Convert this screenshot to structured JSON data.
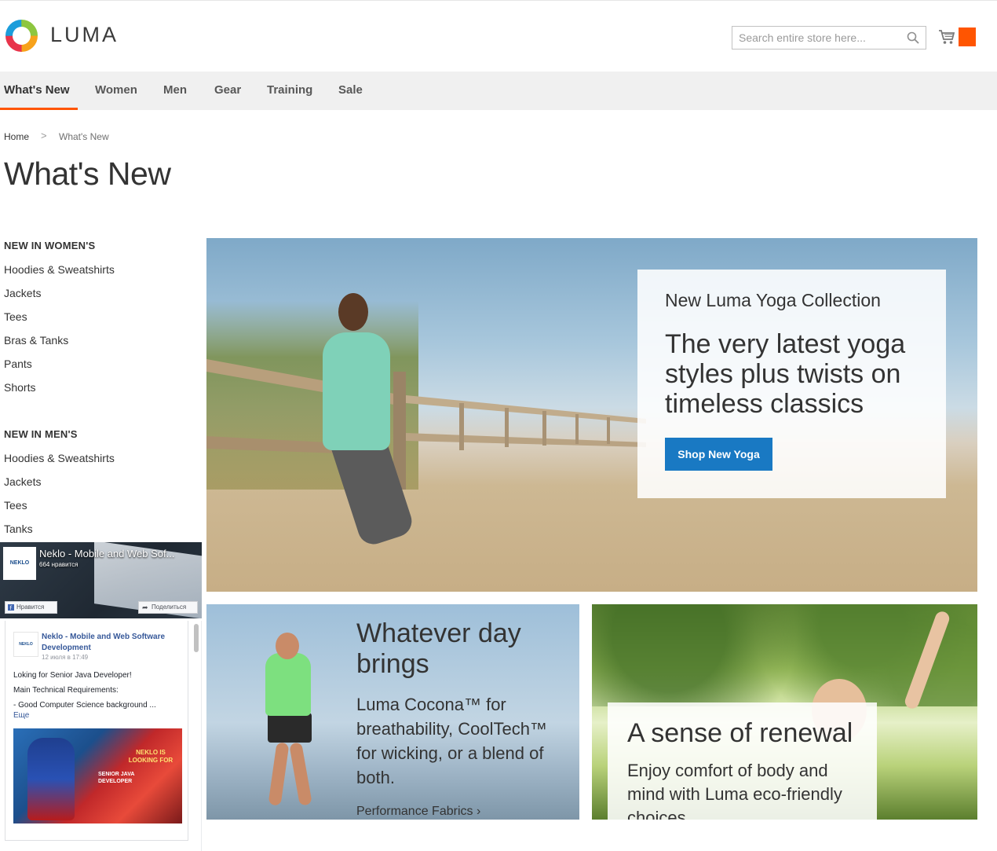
{
  "brand": {
    "name": "LUMA"
  },
  "search": {
    "placeholder": "Search entire store here..."
  },
  "icons": {
    "search": "search-icon",
    "cart": "cart-icon"
  },
  "colors": {
    "accent": "#ff5501",
    "button_primary": "#1979c3",
    "nav_bg": "#f0f0f0"
  },
  "nav": {
    "items": [
      {
        "label": "What's New",
        "active": true
      },
      {
        "label": "Women"
      },
      {
        "label": "Men"
      },
      {
        "label": "Gear"
      },
      {
        "label": "Training"
      },
      {
        "label": "Sale"
      }
    ]
  },
  "breadcrumb": {
    "home": "Home",
    "separator": ">",
    "current": "What's New"
  },
  "page": {
    "title": "What's New"
  },
  "sidebar": {
    "women": {
      "heading": "NEW IN WOMEN'S",
      "items": [
        "Hoodies & Sweatshirts",
        "Jackets",
        "Tees",
        "Bras & Tanks",
        "Pants",
        "Shorts"
      ]
    },
    "men": {
      "heading": "NEW IN MEN'S",
      "items": [
        "Hoodies & Sweatshirts",
        "Jackets",
        "Tees",
        "Tanks"
      ]
    }
  },
  "facebook": {
    "logo_text": "NEKLO",
    "page_name": "Neklo - Mobile and Web Sof...",
    "likes": "664 нравится",
    "like_button": "Нравится",
    "share_button": "Поделиться",
    "post": {
      "author": "Neklo - Mobile and Web Software Development",
      "time": "12 июля в 17:49",
      "lines": [
        "Loking for Senior Java Developer!",
        "Main Technical Requirements:",
        "- Good Computer Science background ..."
      ],
      "more": "Еще",
      "image_text_1": "NEKLO IS LOOKING FOR",
      "image_text_2": "SENIOR JAVA DEVELOPER"
    }
  },
  "hero": {
    "kicker": "New Luma Yoga Collection",
    "headline": "The very latest yoga styles plus twists on timeless classics",
    "button": "Shop New Yoga"
  },
  "promo_run": {
    "title": "Whatever day brings",
    "text": "Luma Cocona™ for breathability, CoolTech™ for wicking, or a blend of both.",
    "link": "Performance Fabrics  ›"
  },
  "promo_renew": {
    "title": "A sense of renewal",
    "text": "Enjoy comfort of body and mind with Luma eco-friendly choices"
  }
}
